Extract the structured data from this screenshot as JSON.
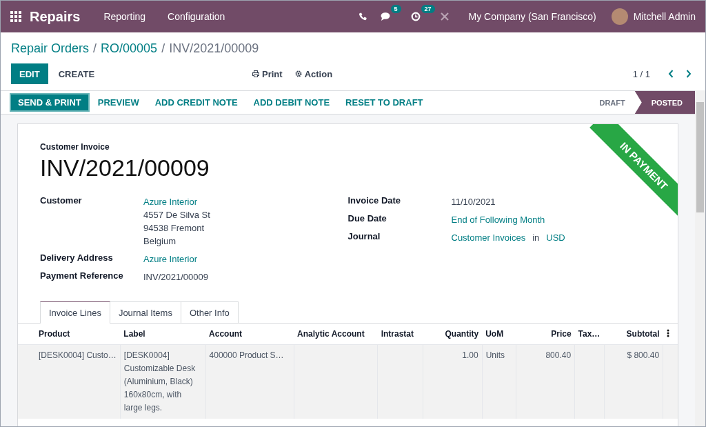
{
  "navbar": {
    "app_name": "Repairs",
    "menu": [
      "Reporting",
      "Configuration"
    ],
    "messages_count": "5",
    "activities_count": "27",
    "company": "My Company (San Francisco)",
    "user": "Mitchell Admin"
  },
  "breadcrumb": [
    {
      "kind": "link",
      "label": "Repair Orders"
    },
    {
      "kind": "separator",
      "label": "/"
    },
    {
      "kind": "link",
      "label": "RO/00005"
    },
    {
      "kind": "separator",
      "label": "/"
    },
    {
      "kind": "current",
      "label": "INV/2021/00009"
    }
  ],
  "control_buttons": [
    {
      "label": "EDIT",
      "primary": true
    },
    {
      "label": "CREATE",
      "primary": false
    }
  ],
  "actions": [
    {
      "kind": "print",
      "label": "Print"
    },
    {
      "kind": "action",
      "label": "Action"
    }
  ],
  "pager": "1 / 1",
  "header_buttons": [
    {
      "label": "SEND & PRINT",
      "primary": true
    },
    {
      "label": "PREVIEW",
      "primary": false
    },
    {
      "label": "ADD CREDIT NOTE",
      "primary": false
    },
    {
      "label": "ADD DEBIT NOTE",
      "primary": false
    },
    {
      "label": "RESET TO DRAFT",
      "primary": false
    }
  ],
  "statusbar": [
    {
      "label": "DRAFT",
      "selected": false
    },
    {
      "label": "POSTED",
      "selected": true
    }
  ],
  "invoice": {
    "type_label": "Customer Invoice",
    "number": "INV/2021/00009",
    "ribbon": "IN PAYMENT",
    "left_fields": [
      {
        "label": "Customer",
        "lines": [
          [
            {
              "text": "Azure Interior",
              "link": true
            }
          ],
          [
            {
              "text": "4557 De Silva St",
              "link": false
            }
          ],
          [
            {
              "text": "94538 Fremont",
              "link": false
            }
          ],
          [
            {
              "text": "Belgium",
              "link": false
            }
          ]
        ]
      },
      {
        "label": "Delivery Address",
        "lines": [
          [
            {
              "text": "Azure Interior",
              "link": true
            }
          ]
        ]
      },
      {
        "label": "Payment Reference",
        "lines": [
          [
            {
              "text": "INV/2021/00009",
              "link": false
            }
          ]
        ]
      }
    ],
    "right_fields": [
      {
        "label": "Invoice Date",
        "lines": [
          [
            {
              "text": "11/10/2021",
              "link": false
            }
          ]
        ]
      },
      {
        "label": "Due Date",
        "lines": [
          [
            {
              "text": "End of Following Month",
              "link": true
            }
          ]
        ]
      },
      {
        "label": "Journal",
        "lines": [
          [
            {
              "text": "Customer Invoices",
              "link": true
            },
            {
              "text": "in",
              "link": false
            },
            {
              "text": "USD",
              "link": true
            }
          ]
        ]
      }
    ]
  },
  "tabs": [
    {
      "label": "Invoice Lines",
      "selected": true
    },
    {
      "label": "Journal Items",
      "selected": false
    },
    {
      "label": "Other Info",
      "selected": false
    }
  ],
  "table": {
    "columns": [
      "Product",
      "Label",
      "Account",
      "Analytic Account",
      "Intrastat",
      "Quantity",
      "UoM",
      "Price",
      "Tax…",
      "Subtotal"
    ],
    "rows": [
      [
        "[DESK0004] Custo…",
        "[DESK0004] Customizable Desk (Aluminium, Black) 160x80cm, with large legs.",
        "400000 Product S…",
        "",
        "",
        "1.00",
        "Units",
        "800.40",
        "",
        "$ 800.40"
      ]
    ]
  }
}
